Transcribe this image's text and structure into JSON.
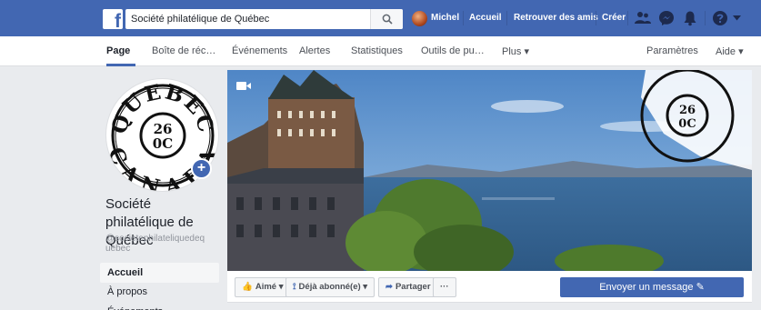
{
  "topbar": {
    "logo": "f",
    "search_value": "Société philatélique de Québec",
    "user_name": "Michel",
    "links": [
      "Accueil",
      "Retrouver des amis",
      "Créer"
    ],
    "icons": [
      "friends-icon",
      "messenger-icon",
      "notifications-icon",
      "help-icon",
      "caret-down-icon"
    ]
  },
  "tabs": {
    "left": [
      "Page",
      "Boîte de réc…",
      "Événements",
      "Alertes",
      "Statistiques",
      "Outils de pu…",
      "Plus ▾"
    ],
    "right": [
      "Paramètres",
      "Aide ▾"
    ]
  },
  "page": {
    "name": "Société philatélique de Québec",
    "handle": "@societephilateliquedequebec",
    "stamp_text": {
      "top": "QUEBEC",
      "bottom": "CANADA",
      "center_top": "26",
      "center_bottom": "0C"
    }
  },
  "sidebar": {
    "items": [
      "Accueil",
      "À propos",
      "Événements"
    ]
  },
  "actions": {
    "liked": "Aimé",
    "subscribed": "Déjà abonné(e)",
    "share": "Partager",
    "more": "···",
    "message": "Envoyer un message"
  },
  "colors": {
    "brand": "#4267b2",
    "background": "#e9ebee"
  }
}
